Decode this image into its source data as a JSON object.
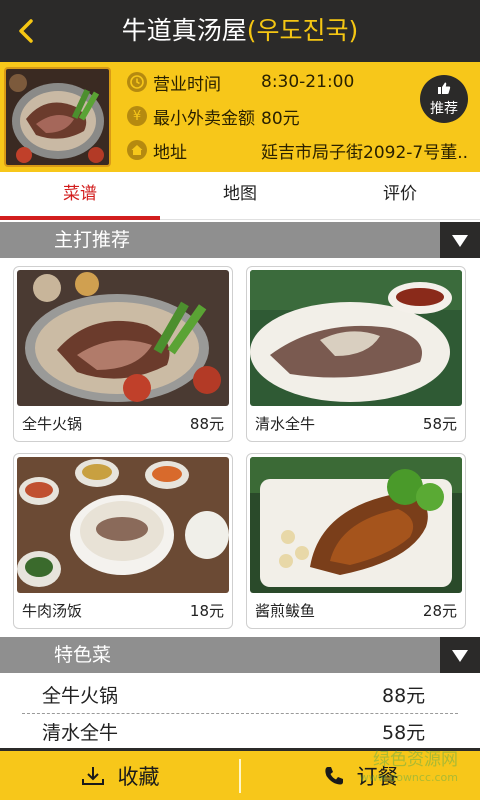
{
  "header": {
    "title": "牛道真汤屋",
    "title_korean": "(우도진국)"
  },
  "info": {
    "rows": [
      {
        "label": "营业时间",
        "value": "8:30-21:00"
      },
      {
        "label": "最小外卖金额",
        "value": "80元"
      },
      {
        "label": "地址",
        "value": "延吉市局子街2092-7号董..."
      }
    ],
    "recommend_label": "推荐"
  },
  "tabs": [
    {
      "label": "菜谱",
      "active": true
    },
    {
      "label": "地图",
      "active": false
    },
    {
      "label": "评价",
      "active": false
    }
  ],
  "main_section": {
    "title": "主打推荐",
    "dishes": [
      {
        "name": "全牛火锅",
        "price": "88元"
      },
      {
        "name": "清水全牛",
        "price": "58元"
      },
      {
        "name": "牛肉汤饭",
        "price": "18元"
      },
      {
        "name": "酱煎鲅鱼",
        "price": "28元"
      }
    ]
  },
  "featured_section": {
    "title": "特色菜",
    "items": [
      {
        "name": "全牛火锅",
        "price": "88元"
      },
      {
        "name": "清水全牛",
        "price": "58元"
      }
    ]
  },
  "bottom": {
    "collect_label": "收藏",
    "order_label": "订餐"
  },
  "watermark": {
    "text": "绿色资源网",
    "url": "www.downcc.com"
  },
  "colors": {
    "topbar": "#2b2a29",
    "accent_yellow": "#f7c71a",
    "active_tab": "#d21d1d",
    "section_bg": "#8f8f8f"
  }
}
